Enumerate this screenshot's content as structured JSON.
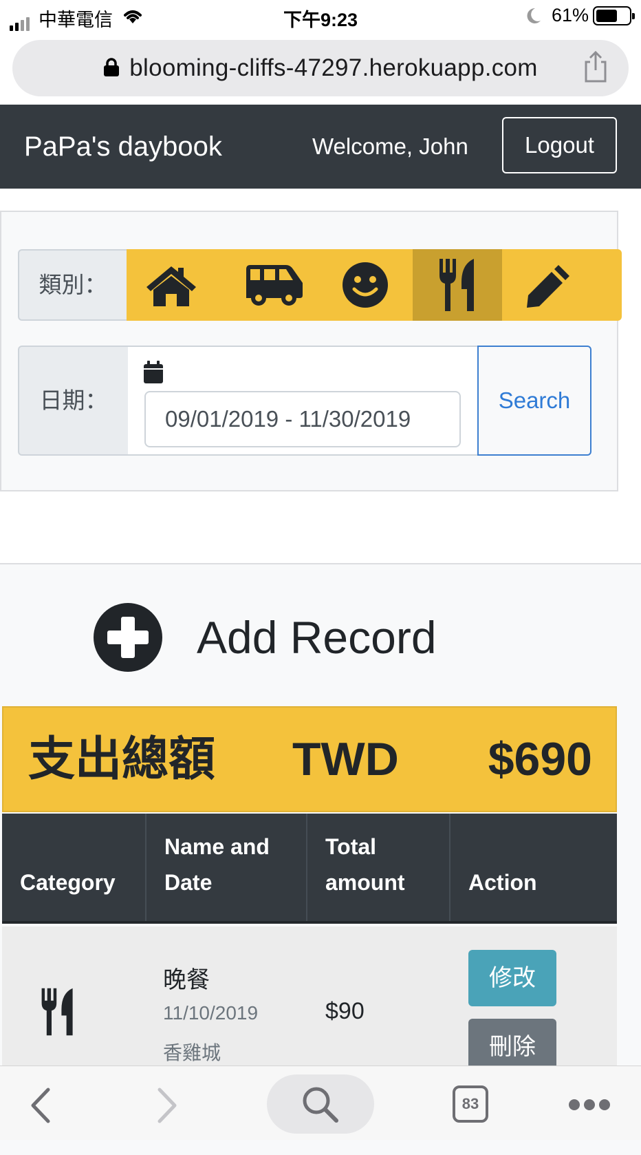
{
  "status_bar": {
    "carrier": "中華電信",
    "time": "下午9:23",
    "battery": "61%"
  },
  "browser": {
    "url": "blooming-cliffs-47297.herokuapp.com",
    "tab_count": "83"
  },
  "navbar": {
    "brand": "PaPa's daybook",
    "welcome": "Welcome, John",
    "logout": "Logout"
  },
  "filter": {
    "category_label": "類別：",
    "categories": [
      {
        "icon": "home-icon",
        "active": false
      },
      {
        "icon": "shuttle-van-icon",
        "active": false
      },
      {
        "icon": "smile-icon",
        "active": false
      },
      {
        "icon": "utensils-icon",
        "active": true
      },
      {
        "icon": "pencil-icon",
        "active": false
      }
    ],
    "date_label": "日期：",
    "date_range": "09/01/2019 - 11/30/2019",
    "search": "Search"
  },
  "records": {
    "add_record": "Add Record",
    "total_label": "支出總額",
    "currency": "TWD",
    "total_amount": "$690",
    "columns": [
      "Category",
      "Name and Date",
      "Total amount",
      "Action"
    ],
    "column_lines": [
      [
        "Category"
      ],
      [
        "Name and",
        "Date"
      ],
      [
        "Total",
        "amount"
      ],
      [
        "Action"
      ]
    ],
    "rows": [
      {
        "category_icon": "utensils-icon",
        "name": "晚餐",
        "date": "11/10/2019",
        "merchant": "香雞城",
        "amount": "$90",
        "edit": "修改",
        "delete": "刪除"
      }
    ]
  },
  "colors": {
    "navbar": "#343a40",
    "accent_yellow": "#f4c23c",
    "edit_button": "#4aa3b8",
    "delete_button": "#6c757d",
    "search_blue": "#2f7bd6"
  }
}
